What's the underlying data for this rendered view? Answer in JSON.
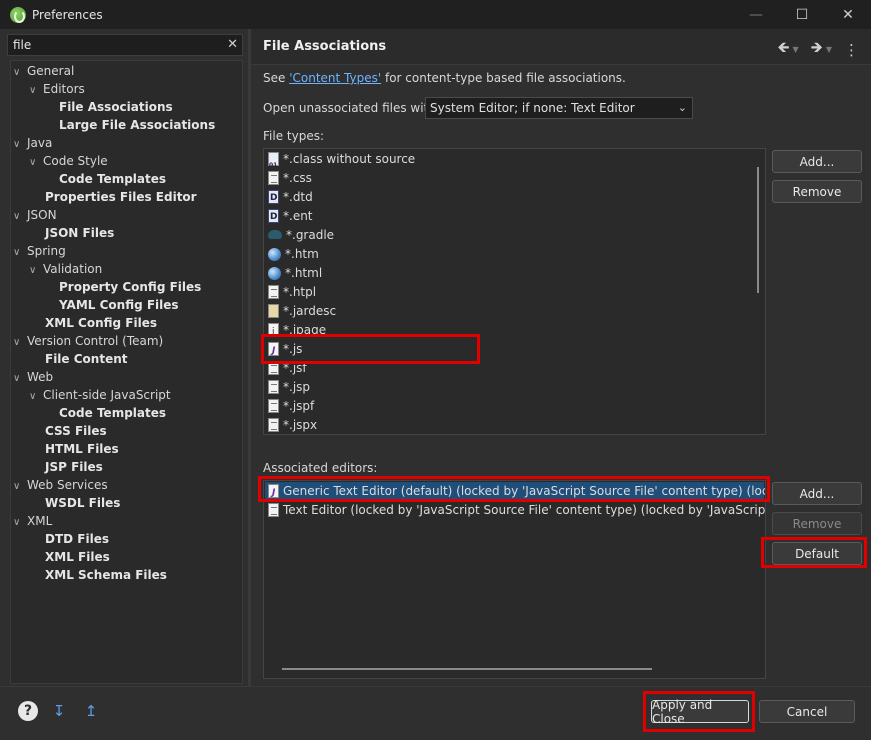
{
  "window": {
    "title": "Preferences",
    "buttons": {
      "minimize": "—",
      "maximize": "☐",
      "close": "✕"
    }
  },
  "left": {
    "filter_value": "file",
    "filter_clear": "✕",
    "tree": [
      {
        "label": "General",
        "level": 0,
        "expanded": true,
        "bold": false
      },
      {
        "label": "Editors",
        "level": 1,
        "expanded": true,
        "bold": false
      },
      {
        "label": "File Associations",
        "level": 2,
        "bold": true,
        "selected": true
      },
      {
        "label": "Large File Associations",
        "level": 2,
        "bold": true
      },
      {
        "label": "Java",
        "level": 0,
        "expanded": true
      },
      {
        "label": "Code Style",
        "level": 1,
        "expanded": true
      },
      {
        "label": "Code Templates",
        "level": 2,
        "bold": true
      },
      {
        "label": "Properties Files Editor",
        "level": 1,
        "bold": true,
        "leaf": true
      },
      {
        "label": "JSON",
        "level": 0,
        "expanded": true
      },
      {
        "label": "JSON Files",
        "level": 1,
        "bold": true,
        "leaf": true
      },
      {
        "label": "Spring",
        "level": 0,
        "expanded": true
      },
      {
        "label": "Validation",
        "level": 1,
        "expanded": true
      },
      {
        "label": "Property Config Files",
        "level": 2,
        "bold": true
      },
      {
        "label": "YAML Config Files",
        "level": 2,
        "bold": true
      },
      {
        "label": "XML Config Files",
        "level": 1,
        "bold": true,
        "leaf": true
      },
      {
        "label": "Version Control (Team)",
        "level": 0,
        "expanded": true
      },
      {
        "label": "File Content",
        "level": 1,
        "bold": true,
        "leaf": true
      },
      {
        "label": "Web",
        "level": 0,
        "expanded": true
      },
      {
        "label": "Client-side JavaScript",
        "level": 1,
        "expanded": true
      },
      {
        "label": "Code Templates",
        "level": 2,
        "bold": true
      },
      {
        "label": "CSS Files",
        "level": 1,
        "bold": true,
        "leaf": true
      },
      {
        "label": "HTML Files",
        "level": 1,
        "bold": true,
        "leaf": true
      },
      {
        "label": "JSP Files",
        "level": 1,
        "bold": true,
        "leaf": true
      },
      {
        "label": "Web Services",
        "level": 0,
        "expanded": true
      },
      {
        "label": "WSDL Files",
        "level": 1,
        "bold": true,
        "leaf": true
      },
      {
        "label": "XML",
        "level": 0,
        "expanded": true
      },
      {
        "label": "DTD Files",
        "level": 1,
        "bold": true,
        "leaf": true
      },
      {
        "label": "XML Files",
        "level": 1,
        "bold": true,
        "leaf": true
      },
      {
        "label": "XML Schema Files",
        "level": 1,
        "bold": true,
        "leaf": true
      }
    ]
  },
  "page": {
    "title": "File Associations",
    "see_prefix": "See ",
    "see_link": "'Content Types'",
    "see_suffix": " for content-type based file associations.",
    "open_unassociated_label": "Open unassociated files with:",
    "open_unassociated_value": "System Editor; if none: Text Editor",
    "file_types_label": "File types:",
    "file_types": [
      {
        "name": "*.class without source",
        "icon": "cls"
      },
      {
        "name": "*.css",
        "icon": "lines"
      },
      {
        "name": "*.dtd",
        "icon": "dbox"
      },
      {
        "name": "*.ent",
        "icon": "dbox"
      },
      {
        "name": "*.gradle",
        "icon": "gradle"
      },
      {
        "name": "*.htm",
        "icon": "globe"
      },
      {
        "name": "*.html",
        "icon": "globe"
      },
      {
        "name": "*.htpl",
        "icon": "lines"
      },
      {
        "name": "*.jardesc",
        "icon": "jar"
      },
      {
        "name": "*.jpage",
        "icon": "jsp"
      },
      {
        "name": "*.js",
        "icon": "js"
      },
      {
        "name": "*.jsf",
        "icon": "lines"
      },
      {
        "name": "*.jsp",
        "icon": "lines"
      },
      {
        "name": "*.jspf",
        "icon": "lines"
      },
      {
        "name": "*.jspx",
        "icon": "lines"
      }
    ],
    "file_add": "Add...",
    "file_remove": "Remove",
    "associated_editors_label": "Associated editors:",
    "editors": [
      {
        "name": "Generic Text Editor (default) (locked by 'JavaScript Source File' content type) (locked by 'JavaScript' content type)",
        "icon": "js",
        "selected": true
      },
      {
        "name": "Text Editor (locked by 'JavaScript Source File' content type) (locked by 'JavaScript' content type)",
        "icon": "lines"
      }
    ],
    "editor_add": "Add...",
    "editor_remove": "Remove",
    "editor_default": "Default"
  },
  "footer": {
    "apply_close": "Apply and Close",
    "cancel": "Cancel"
  },
  "colors": {
    "highlight": "#e00000",
    "selection": "#1f4e7a",
    "link": "#6fb3ff"
  }
}
